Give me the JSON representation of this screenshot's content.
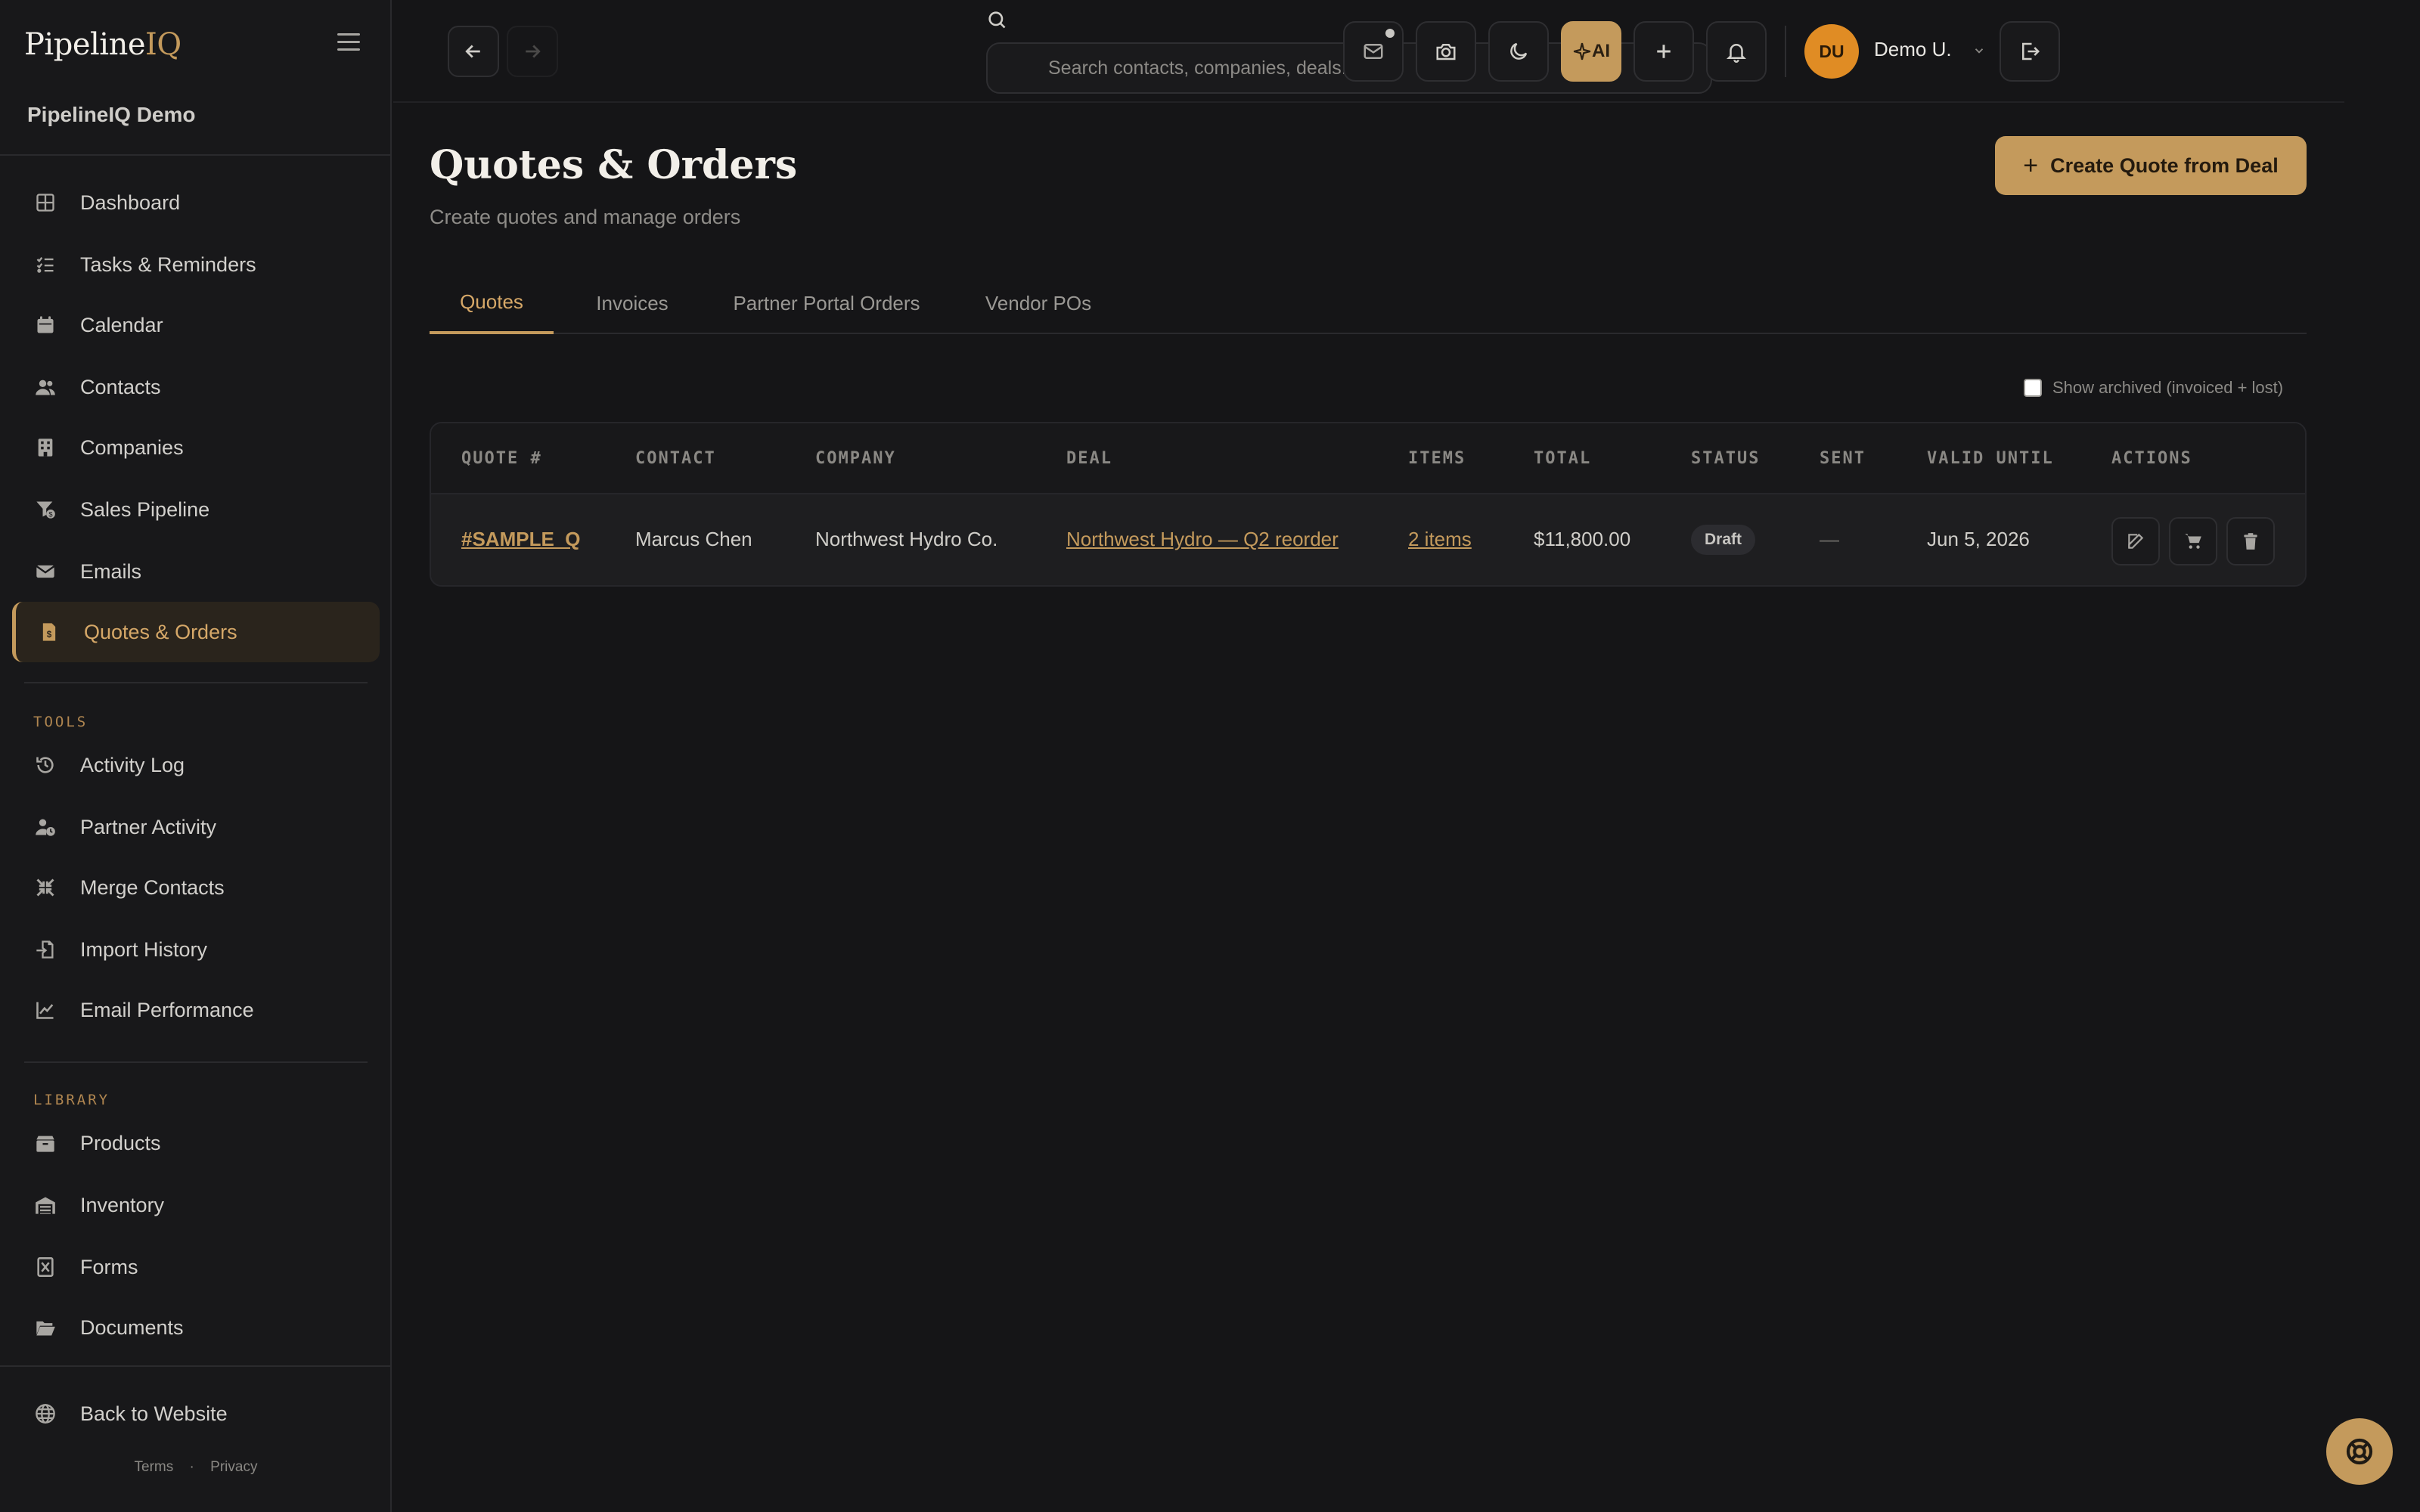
{
  "app": {
    "brand_main": "Pipeline",
    "brand_accent": "IQ",
    "org_name": "PipelineIQ Demo"
  },
  "sidebar": {
    "main_items": [
      {
        "label": "Dashboard",
        "icon": "dashboard-icon"
      },
      {
        "label": "Tasks & Reminders",
        "icon": "tasks-icon"
      },
      {
        "label": "Calendar",
        "icon": "calendar-icon"
      },
      {
        "label": "Contacts",
        "icon": "contacts-icon"
      },
      {
        "label": "Companies",
        "icon": "building-icon"
      },
      {
        "label": "Sales Pipeline",
        "icon": "funnel-icon"
      },
      {
        "label": "Emails",
        "icon": "envelope-icon"
      },
      {
        "label": "Quotes & Orders",
        "icon": "invoice-icon",
        "active": true
      }
    ],
    "tools_label": "TOOLS",
    "tools_items": [
      {
        "label": "Activity Log",
        "icon": "history-icon"
      },
      {
        "label": "Partner Activity",
        "icon": "user-clock-icon"
      },
      {
        "label": "Merge Contacts",
        "icon": "merge-icon"
      },
      {
        "label": "Import History",
        "icon": "file-import-icon"
      },
      {
        "label": "Email Performance",
        "icon": "line-chart-icon"
      }
    ],
    "library_label": "LIBRARY",
    "library_items": [
      {
        "label": "Products",
        "icon": "boxes-icon"
      },
      {
        "label": "Inventory",
        "icon": "warehouse-icon"
      },
      {
        "label": "Forms",
        "icon": "form-icon"
      },
      {
        "label": "Documents",
        "icon": "folder-open-icon"
      }
    ],
    "back_to_website": "Back to Website",
    "footer": {
      "terms": "Terms",
      "separator": "·",
      "privacy": "Privacy"
    }
  },
  "topbar": {
    "search_placeholder": "Search contacts, companies, deals...",
    "ai_label": "AI",
    "user_initials": "DU",
    "user_name": "Demo U."
  },
  "page": {
    "title": "Quotes & Orders",
    "subtitle": "Create quotes and manage orders",
    "create_button": "Create Quote from Deal",
    "tabs": [
      "Quotes",
      "Invoices",
      "Partner Portal Orders",
      "Vendor POs"
    ],
    "active_tab": "Quotes",
    "show_archived_label": "Show archived (invoiced + lost)",
    "show_archived_checked": false
  },
  "table": {
    "columns": [
      "QUOTE #",
      "CONTACT",
      "COMPANY",
      "DEAL",
      "ITEMS",
      "TOTAL",
      "STATUS",
      "SENT",
      "VALID UNTIL",
      "ACTIONS"
    ],
    "rows": [
      {
        "quote": "#SAMPLE_Q",
        "contact": "Marcus Chen",
        "company": "Northwest Hydro Co.",
        "deal": "Northwest Hydro — Q2 reorder",
        "items": "2 items",
        "total": "$11,800.00",
        "status": "Draft",
        "sent": "—",
        "valid_until": "Jun 5, 2026"
      }
    ]
  },
  "colors": {
    "accent": "#c49a5c",
    "background": "#151517",
    "avatar": "#e08c24"
  }
}
